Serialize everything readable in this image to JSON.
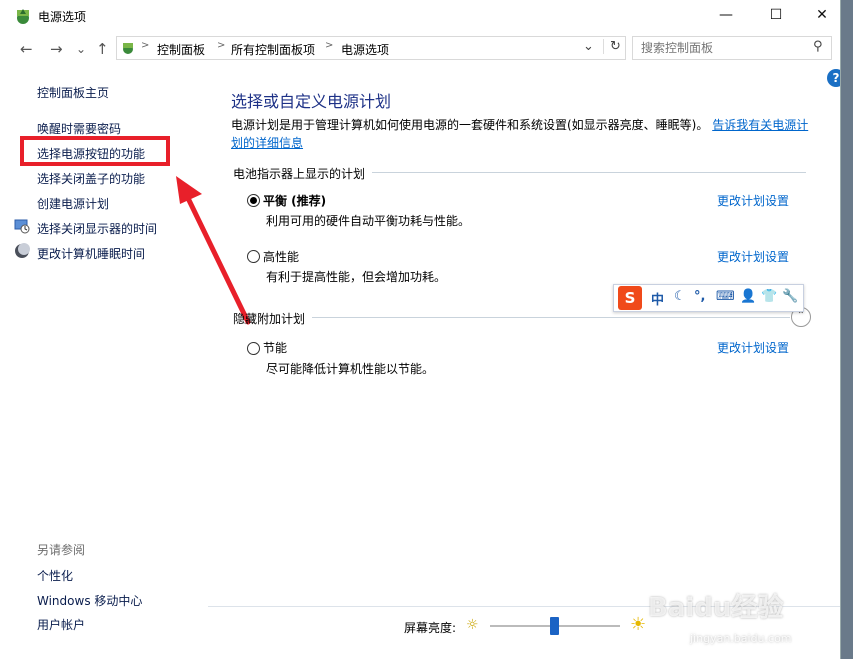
{
  "window": {
    "title": "电源选项",
    "minimize": "—",
    "maximize": "☐",
    "close": "✕"
  },
  "address": {
    "back": "←",
    "forward": "→",
    "recent": "⌄",
    "up": "↑",
    "breadcrumb": [
      "控制面板",
      "所有控制面板项",
      "电源选项"
    ],
    "dropdown": "⌄",
    "refresh": "↻",
    "search_placeholder": "搜索控制面板",
    "search_icon": "⚲"
  },
  "help": "?",
  "sidebar": {
    "home": "控制面板主页",
    "items": [
      {
        "label": "唤醒时需要密码"
      },
      {
        "label": "选择电源按钮的功能"
      },
      {
        "label": "选择关闭盖子的功能"
      },
      {
        "label": "创建电源计划"
      },
      {
        "label": "选择关闭显示器的时间"
      },
      {
        "label": "更改计算机睡眠时间"
      }
    ],
    "see_also": "另请参阅",
    "see_also_items": [
      {
        "label": "个性化"
      },
      {
        "label": "Windows 移动中心"
      },
      {
        "label": "用户帐户"
      }
    ]
  },
  "main": {
    "title": "选择或自定义电源计划",
    "desc_text": "电源计划是用于管理计算机如何使用电源的一套硬件和系统设置(如显示器亮度、睡眠等)。",
    "desc_link_1": "告诉我有关电源计",
    "desc_link_2": "划的详细信息",
    "group_battery": "电池指示器上显示的计划",
    "group_hidden": "隐藏附加计划",
    "plans": [
      {
        "name": "平衡 (推荐)",
        "desc": "利用可用的硬件自动平衡功耗与性能。",
        "change": "更改计划设置",
        "selected": true
      },
      {
        "name": "高性能",
        "desc": "有利于提高性能，但会增加功耗。",
        "change": "更改计划设置",
        "selected": false
      },
      {
        "name": "节能",
        "desc": "尽可能降低计算机性能以节能。",
        "change": "更改计划设置",
        "selected": false
      }
    ],
    "expander": "⌃"
  },
  "ime": {
    "logo": "S",
    "lang": "中",
    "moon": "☾",
    "punct": "°,",
    "keyboard": "⌨",
    "user": "👤",
    "shirt": "👕",
    "tool": "🔧"
  },
  "brightness": {
    "label": "屏幕亮度:",
    "low_icon": "☼",
    "high_icon": "☀",
    "level": 0.49
  },
  "watermark": {
    "text": "Baidu经验",
    "sub": "jingyan.baidu.com"
  },
  "colors": {
    "link": "#0066cc",
    "title": "#1e3287",
    "highlight": "#e8202a",
    "arrow": "#e8202a",
    "slider": "#1b63c4"
  }
}
